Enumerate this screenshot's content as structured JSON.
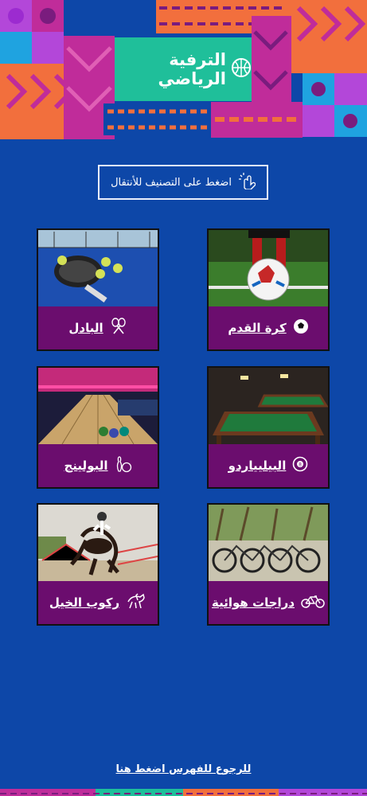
{
  "header": {
    "title": "الترفية الرياضي",
    "icon": "basketball-icon"
  },
  "instruction": {
    "text": "اضغط على التصنيف للأنتقال",
    "icon": "tap-hand-icon"
  },
  "categories": [
    {
      "label": "كرة القدم",
      "icon": "soccer-ball-icon",
      "photo": "football-photo"
    },
    {
      "label": "البادل",
      "icon": "crossed-rackets-icon",
      "photo": "padel-photo"
    },
    {
      "label": "البيليياردو",
      "icon": "billiard-ball-8-icon",
      "photo": "billiards-photo"
    },
    {
      "label": "البولينج",
      "icon": "bowling-icon",
      "photo": "bowling-photo"
    },
    {
      "label": "دراجات هوائية",
      "icon": "bicycle-icon",
      "photo": "bicycles-photo"
    },
    {
      "label": "ركوب الخيل",
      "icon": "horse-riding-icon",
      "photo": "horse-riding-photo"
    }
  ],
  "back_link": {
    "text": "للرجوع للفهرس اضغط هنا"
  },
  "colors": {
    "background": "#0d47a8",
    "card": "#6b0d6e",
    "teal": "#1fbf9a",
    "orange": "#f26f3d",
    "magenta": "#c02c9a"
  }
}
